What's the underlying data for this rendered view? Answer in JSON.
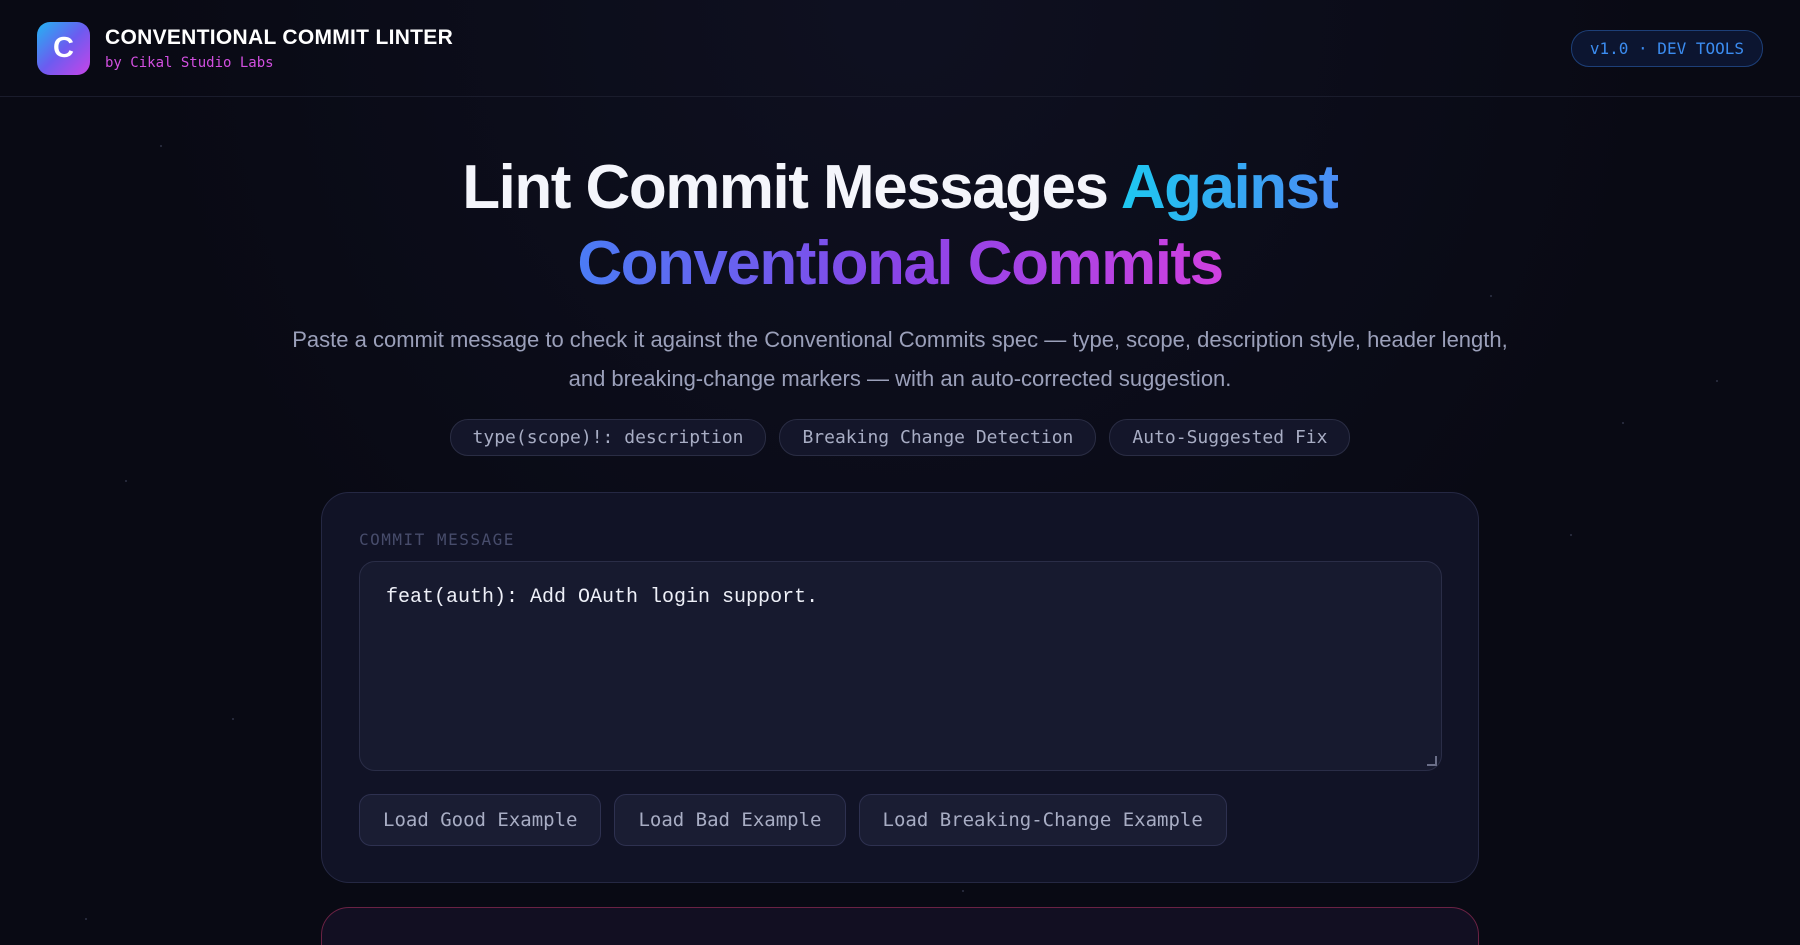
{
  "header": {
    "logo_letter": "C",
    "title": "CONVENTIONAL COMMIT LINTER",
    "subtitle": "by Cikal Studio Labs",
    "version_badge": "v1.0 · DEV TOOLS"
  },
  "hero": {
    "title_part1": "Lint Commit Messages ",
    "title_part2": "Against",
    "title_part3": "Conventional Commits",
    "description_line1": "Paste a commit message to check it against the Conventional Commits spec — type, scope, description style, header length,",
    "description_line2": "and breaking-change markers — with an auto-corrected suggestion.",
    "pills": [
      "type(scope)!: description",
      "Breaking Change Detection",
      "Auto-Suggested Fix"
    ]
  },
  "editor": {
    "label": "COMMIT MESSAGE",
    "value": "feat(auth): Add OAuth login support.",
    "buttons": {
      "good": "Load Good Example",
      "bad": "Load Bad Example",
      "breaking": "Load Breaking-Change Example"
    }
  },
  "colors": {
    "background": "#090a14",
    "accent_cyan": "#1ec8f0",
    "accent_purple": "#8a44e8",
    "accent_magenta": "#d040e0",
    "badge_blue": "#3b8cf0",
    "error_border": "#6a2244"
  }
}
